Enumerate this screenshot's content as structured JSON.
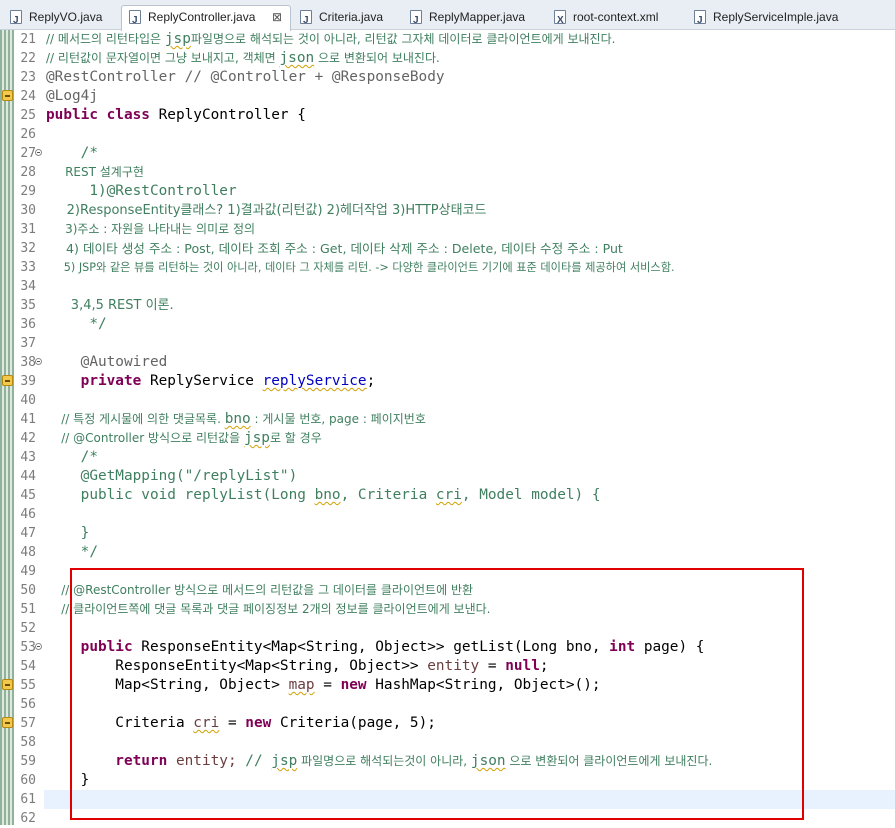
{
  "tabs": [
    {
      "label": "ReplyVO.java",
      "icon": "java-file-icon"
    },
    {
      "label": "ReplyController.java",
      "icon": "java-file-icon",
      "active": true,
      "close": "⊠"
    },
    {
      "label": "Criteria.java",
      "icon": "java-file-icon"
    },
    {
      "label": "ReplyMapper.java",
      "icon": "java-file-icon"
    },
    {
      "label": "root-context.xml",
      "icon": "xml-file-icon"
    },
    {
      "label": "ReplyServiceImple.java",
      "icon": "java-file-icon"
    }
  ],
  "lines": {
    "n21": "21",
    "n22": "22",
    "n23": "23",
    "n24": "24",
    "n25": "25",
    "n26": "26",
    "n27": "27",
    "n28": "28",
    "n29": "29",
    "n30": "30",
    "n31": "31",
    "n32": "32",
    "n33": "33",
    "n34": "34",
    "n35": "35",
    "n36": "36",
    "n37": "37",
    "n38": "38",
    "n39": "39",
    "n40": "40",
    "n41": "41",
    "n42": "42",
    "n43": "43",
    "n44": "44",
    "n45": "45",
    "n46": "46",
    "n47": "47",
    "n48": "48",
    "n49": "49",
    "n50": "50",
    "n51": "51",
    "n52": "52",
    "n53": "53",
    "n54": "54",
    "n55": "55",
    "n56": "56",
    "n57": "57",
    "n58": "58",
    "n59": "59",
    "n60": "60",
    "n61": "61",
    "n62": "62"
  },
  "code": {
    "l21a": "// 메서드의 리턴타입은 ",
    "l21b": "jsp",
    "l21c": "파일명으로 해석되는 것이 아니라, 리턴값 그자체 데이터로 클라이언트에게 보내진다.",
    "l22a": "// 리턴값이 문자열이면 그냥 보내지고, 객체면 ",
    "l22b": "json",
    "l22c": " 으로 변환되어 보내진다.",
    "l23": "@RestController // @Controller + @ResponseBody",
    "l24": "@Log4j",
    "l25a": "public class",
    "l25b": " ReplyController {",
    "l27": "    /*",
    "l28": "     REST 설계구현",
    "l29": "     1)@RestController",
    "l30": "     2)ResponseEntity클래스? 1)결과값(리턴값) 2)헤더작업 3)HTTP상태코드",
    "l31": "     3)주소 : 자원을 나타내는 의미로 정의",
    "l32": "     4) 데이타 생성 주소 : Post, 데이타 조회 주소 : Get, 데이타 삭제 주소 : Delete, 데이타 수정 주소 : Put",
    "l33": "     5) JSP와 같은 뷰를 리턴하는 것이 아니라, 데이타 그 자체를 리턴. -> 다양한 클라이언트 기기에 표준 데이타를 제공하여 서비스함.",
    "l35": "      3,4,5 REST 이론.",
    "l36": "     */",
    "l38": "    @Autowired",
    "l39a": "    private",
    "l39b": " ReplyService ",
    "l39c": "replyService",
    "l39d": ";",
    "l41a": "    // 특정 게시물에 의한 댓글목록. ",
    "l41b": "bno",
    "l41c": " : 게시물 번호, page : 페이지번호",
    "l42a": "    // @Controller 방식으로 리턴값을 ",
    "l42b": "jsp",
    "l42c": "로 할 경우",
    "l43": "    /*",
    "l44": "    @GetMapping(\"/replyList\")",
    "l45a": "    public void replyList(Long ",
    "l45b": "bno",
    "l45c": ", Criteria ",
    "l45d": "cri",
    "l45e": ", Model model) {",
    "l47": "    }",
    "l48": "    */",
    "l50": "    // @RestController 방식으로 메서드의 리턴값을 그 데이터를 클라이언트에 반환",
    "l51": "    // 클라이언트쪽에 댓글 목록과 댓글 페이징정보 2개의 정보를 클라이언트에게 보낸다.",
    "l53a": "    public",
    "l53b": " ResponseEntity<Map<String, Object>> getList(Long bno, ",
    "l53c": "int",
    "l53d": " page) {",
    "l54a": "        ResponseEntity<Map<String, Object>> ",
    "l54b": "entity",
    "l54c": " = ",
    "l54d": "null",
    "l54e": ";",
    "l55a": "        Map<String, Object> ",
    "l55b": "map",
    "l55c": " = ",
    "l55d": "new",
    "l55e": " HashMap<String, Object>();",
    "l57a": "        Criteria ",
    "l57b": "cri",
    "l57c": " = ",
    "l57d": "new",
    "l57e": " Criteria(page, 5);",
    "l59a": "        return",
    "l59b": " entity; ",
    "l59c": "// ",
    "l59d": "jsp",
    "l59e": " 파일명으로 해석되는것이 아니라, ",
    "l59f": "json",
    "l59g": " 으로 변환되어 클라이언트에게 보내진다.",
    "l60": "    }"
  }
}
